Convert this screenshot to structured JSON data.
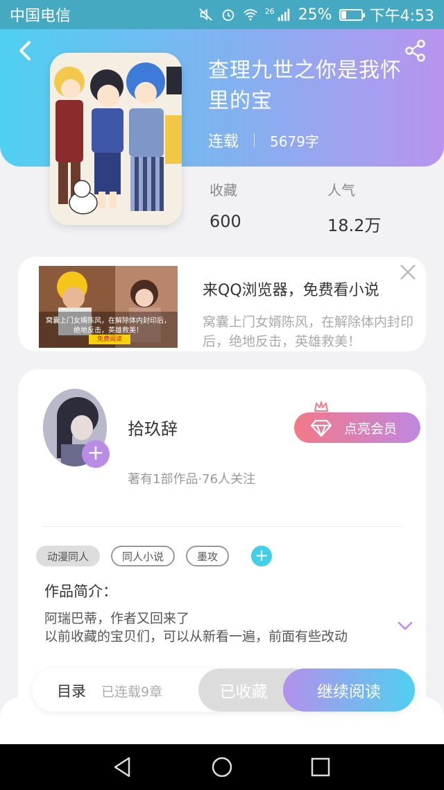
{
  "status_bar": {
    "carrier": "中国电信",
    "network": "26",
    "battery_percent": "25%",
    "battery_level": 0.25,
    "time": "下午4:53"
  },
  "book": {
    "title": "查理九世之你是我怀里的宝",
    "status": "连载",
    "word_count": "5679字",
    "stats": {
      "favorites_label": "收藏",
      "favorites_value": "600",
      "popularity_label": "人气",
      "popularity_value": "18.2万"
    }
  },
  "ad": {
    "title": "来QQ浏览器，免费看小说",
    "description": "窝囊上门女婿陈风，在解除体内封印后，绝地反击，英雄救美！",
    "image_caption_line1": "窝囊上门女婿陈风，在解除体内封印后，",
    "image_caption_line2": "绝地反击，英雄救美！",
    "image_button": "免费阅读"
  },
  "author": {
    "name": "拾玖辞",
    "meta": "著有1部作品·76人关注",
    "vip_button": "点亮会员"
  },
  "tags": [
    "动漫同人",
    "同人小说",
    "墨攻"
  ],
  "intro": {
    "label": "作品简介：",
    "line1": "阿瑞巴蒂，作者又回来了",
    "line2": "以前收藏的宝贝们，可以从新看一遍，前面有些改动"
  },
  "actions": {
    "catalog": "目录",
    "chapters": "已连载9章",
    "collected": "已收藏",
    "continue_reading": "继续阅读"
  },
  "colors": {
    "header_gradient_start": "#4fd0f0",
    "header_gradient_end": "#b994ee",
    "accent_purple": "#b98de6",
    "accent_cyan": "#43cfe8",
    "vip_pink": "#f37888"
  },
  "icons": [
    "back-icon",
    "share-icon",
    "close-icon",
    "avatar-add-icon",
    "crown-icon",
    "diamond-icon",
    "tag-add-icon",
    "chevron-down-icon",
    "nav-back-icon",
    "nav-home-icon",
    "nav-recents-icon"
  ]
}
